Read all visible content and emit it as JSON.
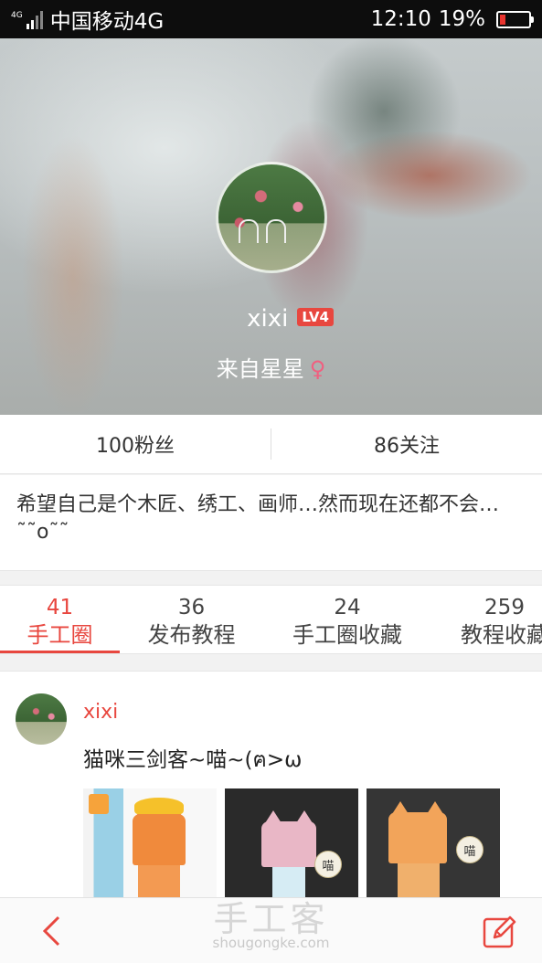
{
  "status_bar": {
    "network_small": "4G",
    "carrier": "中国移动4G",
    "time": "12:10",
    "battery_percent": "19%",
    "battery_level": 0.19
  },
  "profile": {
    "username": "xixi",
    "level_badge": "LV4",
    "location": "来自星星",
    "gender_icon": "♀"
  },
  "stats": {
    "followers": "100粉丝",
    "following": "86关注"
  },
  "bio": "希望自己是个木匠、绣工、画师…然而现在还都不会…˜˜o˜˜",
  "tabs": [
    {
      "count": "41",
      "label": "手工圈"
    },
    {
      "count": "36",
      "label": "发布教程"
    },
    {
      "count": "24",
      "label": "手工圈收藏"
    },
    {
      "count": "259",
      "label": "教程收藏"
    }
  ],
  "post": {
    "author": "xixi",
    "title": "猫咪三剑客~喵~(ฅ>ω",
    "bubble_text": "喵"
  },
  "bottom_bar": {
    "watermark": "手工客",
    "watermark_url": "shougongke.com"
  },
  "colors": {
    "accent": "#e8473f",
    "status_bar_bg": "#0d0d0d"
  }
}
